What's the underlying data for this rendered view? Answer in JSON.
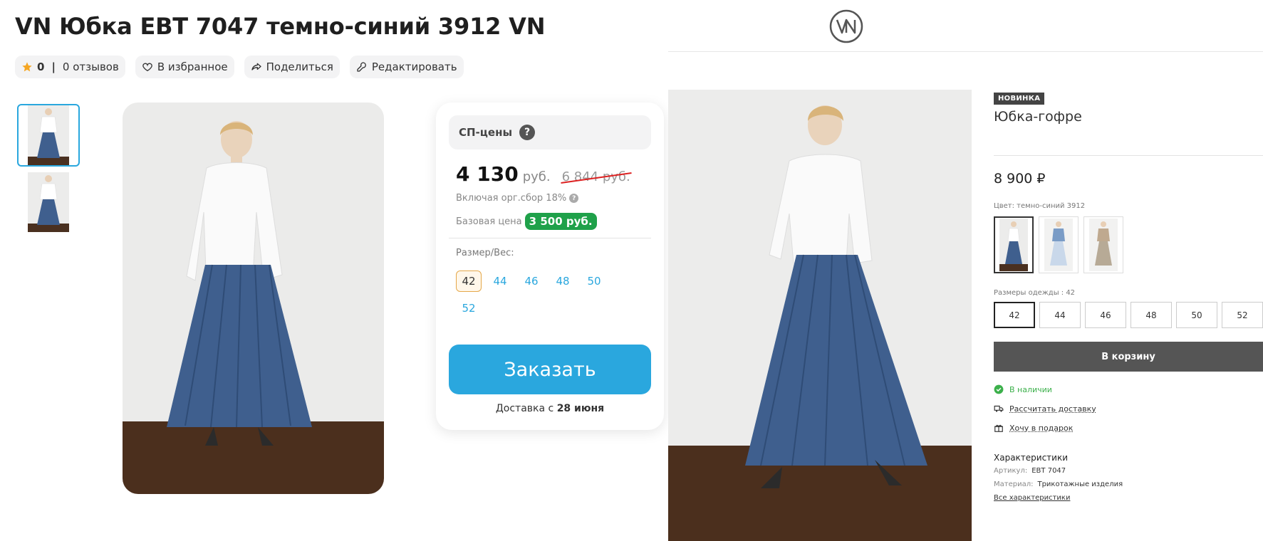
{
  "left": {
    "title": "VN Юбка EBT 7047 темно-синий 3912 VN",
    "actions": {
      "rating": "0",
      "rating_sep": "|",
      "reviews": "0 отзывов",
      "favorite": "В избранное",
      "share": "Поделиться",
      "edit": "Редактировать"
    },
    "card": {
      "sp_label": "СП-цены",
      "help_mark": "?",
      "price": "4 130",
      "currency": "руб.",
      "old_price": "6 844 руб.",
      "fee_note": "Включая орг.сбор 18%",
      "base_label": "Базовая цена",
      "base_price": "3 500 руб.",
      "size_label": "Размер/Вес:",
      "sizes": [
        "42",
        "44",
        "46",
        "48",
        "50",
        "52"
      ],
      "selected_size": "42",
      "order_button": "Заказать",
      "delivery_prefix": "Доставка с",
      "delivery_date": "28 июня"
    }
  },
  "right": {
    "badge": "НОВИНКА",
    "product_name": "Юбка-гофре",
    "price": "8 900 ₽",
    "color_label": "Цвет: темно-синий 3912",
    "sizes_label": "Размеры одежды : 42",
    "sizes": [
      "42",
      "44",
      "46",
      "48",
      "50",
      "52"
    ],
    "selected_size": "42",
    "cart_button": "В корзину",
    "in_stock": "В наличии",
    "calc_delivery": "Рассчитать доставку",
    "gift": "Хочу в подарок",
    "specs_title": "Характеристики",
    "article_key": "Артикул:",
    "article_value": "EBT 7047",
    "material_key": "Материал:",
    "material_value": "Трикотажные изделия",
    "all_specs": "Все характеристики"
  },
  "colors": {
    "accent_blue": "#2aa7de",
    "base_green": "#1fa14a",
    "strike_red": "#dd2222",
    "in_stock_green": "#3cb04b",
    "cart_gray": "#555555"
  },
  "icons": [
    "star-icon",
    "heart-icon",
    "share-icon",
    "wrench-icon",
    "help-icon",
    "check-circle-icon",
    "truck-icon",
    "gift-icon",
    "vn-logo"
  ]
}
